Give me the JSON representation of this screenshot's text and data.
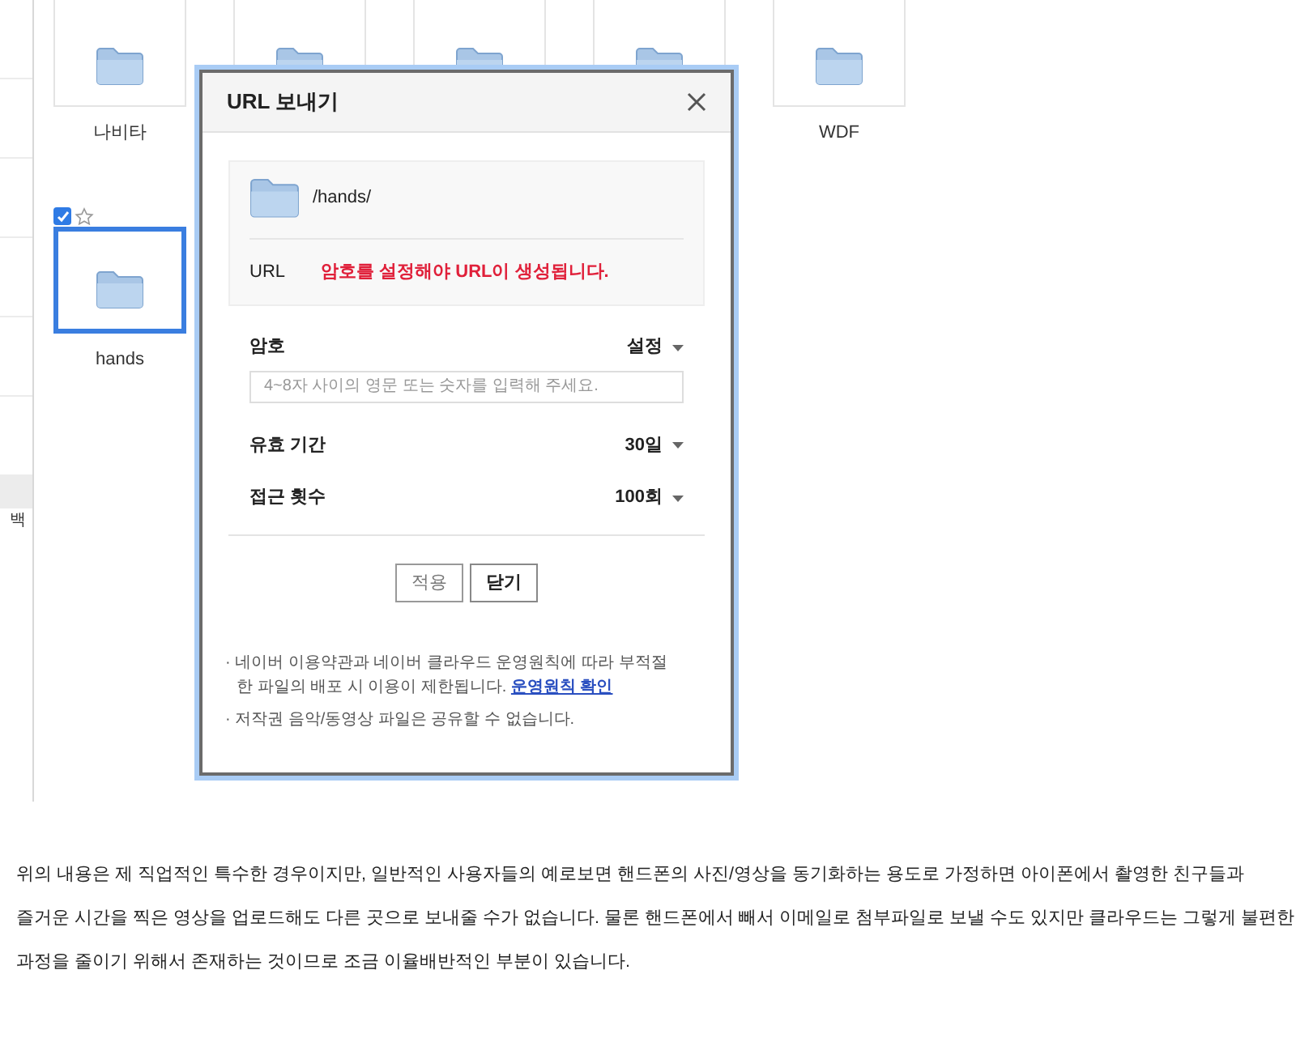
{
  "sidebar": {
    "cut_label": "백"
  },
  "folders": [
    {
      "name": "나비타",
      "selected": false
    },
    {
      "selected": false
    },
    {
      "selected": false
    },
    {
      "selected": false
    },
    {
      "name": "WDF",
      "selected": false
    }
  ],
  "second_row": [
    {
      "name": "hands",
      "selected": true,
      "checked": true,
      "starred": false
    }
  ],
  "dialog": {
    "title": "URL 보내기",
    "path": "/hands/",
    "url_label": "URL",
    "url_message": "암호를 설정해야 URL이 생성됩니다.",
    "password": {
      "label": "암호",
      "value": "설정",
      "placeholder": "4~8자 사이의 영문 또는 숫자를 입력해 주세요."
    },
    "options": [
      {
        "label": "유효 기간",
        "value": "30일"
      },
      {
        "label": "접근 횟수",
        "value": "100회"
      }
    ],
    "buttons": [
      {
        "label": "적용",
        "primary": false
      },
      {
        "label": "닫기",
        "primary": true
      }
    ],
    "notes": [
      {
        "text": "· 네이버 이용약관과 네이버 클라우드 운영원칙에 따라 부적절한 파일의 배포 시 이용이 제한됩니다.",
        "link": "운영원칙 확인"
      },
      {
        "text": "· 저작권 음악/동영상 파일은 공유할 수 없습니다."
      }
    ]
  },
  "article": {
    "lines": [
      "위의 내용은 제 직업적인 특수한 경우이지만, 일반적인 사용자들의 예로보면 핸드폰의 사진/영상을 동기화하는 용도로 가정하면 아이폰에서 촬영한 친구들과",
      "즐거운 시간을 찍은 영상을 업로드해도 다른 곳으로 보내줄 수가 없습니다. 물론 핸드폰에서 빼서 이메일로 첨부파일로 보낼 수도 있지만 클라우드는 그렇게 불편한",
      "과정을 줄이기 위해서 존재하는 것이므로 조금 이율배반적인 부분이 있습니다."
    ]
  }
}
